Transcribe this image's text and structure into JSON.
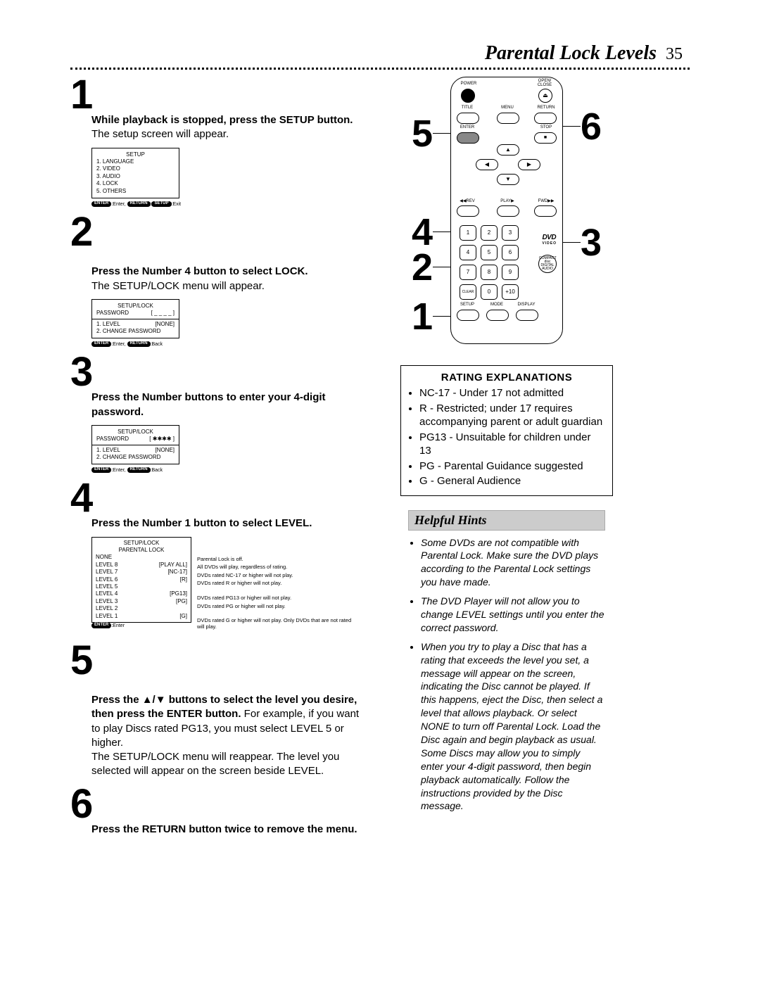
{
  "header": {
    "title": "Parental Lock Levels",
    "page": "35"
  },
  "steps": {
    "s1": {
      "num": "1",
      "bold": "While playback is stopped, press the SETUP button.",
      "rest": " The setup screen will appear.",
      "menu": {
        "title": "SETUP",
        "items": [
          "1. LANGUAGE",
          "2. VIDEO",
          "3. AUDIO",
          "4. LOCK",
          "5. OTHERS"
        ]
      },
      "caption_parts": {
        "enter": "ENTER",
        "t1": ":Enter, ",
        "ret": "RETURN",
        "t2": ":",
        "setup": "SETUP",
        "t3": ":Exit"
      }
    },
    "s2": {
      "num": "2",
      "bold": "Press the Number 4 button to select LOCK.",
      "rest": "\nThe SETUP/LOCK menu will appear.",
      "menu": {
        "title": "SETUP/LOCK",
        "pw_label": "PASSWORD",
        "pw_value": "[ _ _ _ _ ]",
        "rows": [
          {
            "l": "1. LEVEL",
            "r": "[NONE]"
          },
          {
            "l": "2. CHANGE PASSWORD",
            "r": ""
          }
        ]
      },
      "caption_parts": {
        "enter": "ENTER",
        "t1": ":Enter, ",
        "ret": "RETURN",
        "t2": ":Back"
      }
    },
    "s3": {
      "num": "3",
      "bold": "Press the Number buttons to enter your 4-digit password.",
      "menu": {
        "title": "SETUP/LOCK",
        "pw_label": "PASSWORD",
        "pw_value": "[ ✱✱✱✱ ]",
        "rows": [
          {
            "l": "1. LEVEL",
            "r": "[NONE]"
          },
          {
            "l": "2. CHANGE PASSWORD",
            "r": ""
          }
        ]
      },
      "caption_parts": {
        "enter": "ENTER",
        "t1": ":Enter, ",
        "ret": "RETURN",
        "t2": ":Back"
      }
    },
    "s4": {
      "num": "4",
      "bold": "Press the Number 1 button to select LEVEL.",
      "levels": {
        "title1": "SETUP/LOCK",
        "title2": "PARENTAL LOCK",
        "items": [
          {
            "l": "NONE",
            "r": ""
          },
          {
            "l": "LEVEL 8",
            "r": "[PLAY ALL]"
          },
          {
            "l": "LEVEL 7",
            "r": "[NC-17]"
          },
          {
            "l": "LEVEL 6",
            "r": "[R]"
          },
          {
            "l": "LEVEL 5",
            "r": ""
          },
          {
            "l": "LEVEL 4",
            "r": "[PG13]"
          },
          {
            "l": "LEVEL 3",
            "r": "[PG]"
          },
          {
            "l": "LEVEL 2",
            "r": ""
          },
          {
            "l": "LEVEL 1",
            "r": "[G]"
          }
        ],
        "caption": {
          "enter": "ENTER",
          "t": ":Enter"
        },
        "notes": [
          "Parental Lock is off.",
          "All DVDs will play, regardless of rating.",
          "DVDs rated NC-17 or higher will not play.",
          "DVDs rated R or higher will not play.",
          "",
          "DVDs rated PG13 or higher will not play.",
          "DVDs rated PG or higher will not play.",
          "",
          "DVDs rated G or higher will not play. Only DVDs that are not rated will play."
        ]
      }
    },
    "s5": {
      "num": "5",
      "bold": "Press the ▲/▼ buttons to select the level you desire, then press the ENTER button.",
      "rest": " For example, if you want to play Discs rated PG13, you must select LEVEL 5 or higher.\nThe SETUP/LOCK menu will reappear. The level you selected will appear on the screen beside LEVEL."
    },
    "s6": {
      "num": "6",
      "bold": "Press the RETURN button twice to remove the menu."
    }
  },
  "remote": {
    "labels": {
      "power": "POWER",
      "open": "OPEN/\nCLOSE",
      "title": "TITLE",
      "menu": "MENU",
      "return": "RETURN",
      "enter": "ENTER",
      "stop": "STOP",
      "rev": "◀◀REV",
      "play": "PLAY▶",
      "fwd": "FWD▶▶",
      "clear": "CLEAR",
      "plus10": "+10",
      "setup": "SETUP",
      "mode": "MODE",
      "display": "DISPLAY"
    },
    "nums": {
      "n1": "1",
      "n2": "2",
      "n3": "3",
      "n4": "4",
      "n5": "5",
      "n6": "6",
      "n7": "7",
      "n8": "8",
      "n9": "9",
      "n0": "0"
    },
    "callouts": {
      "c1": "1",
      "c2": "2",
      "c3": "3",
      "c4": "4",
      "c5": "5",
      "c6": "6"
    },
    "dvd": "DVD",
    "dvd_sub": "VIDEO",
    "cd": "COMPACT\ndisc\nDIGITAL AUDIO"
  },
  "ratings": {
    "title": "RATING EXPLANATIONS",
    "items": [
      "NC-17 - Under 17 not admitted",
      "R - Restricted; under 17 requires accompanying parent or adult guardian",
      "PG13 - Unsuitable for children under 13",
      "PG - Parental Guidance suggested",
      "G - General Audience"
    ]
  },
  "hints": {
    "title": "Helpful Hints",
    "items": [
      "Some DVDs are not compatible with Parental Lock. Make sure the DVD plays according to the Parental Lock settings you have made.",
      "The DVD Player will not allow you to change LEVEL settings until you enter the correct password.",
      "When you try to play a Disc that has a rating that exceeds the level you set, a message will appear on the screen, indicating the Disc cannot be played. If this happens, eject the Disc, then select a level that allows playback. Or select NONE to turn off Parental Lock. Load the Disc again and begin playback as usual. Some Discs may allow you to simply enter your 4-digit password, then begin playback automatically. Follow the instructions provided by the Disc message."
    ]
  }
}
